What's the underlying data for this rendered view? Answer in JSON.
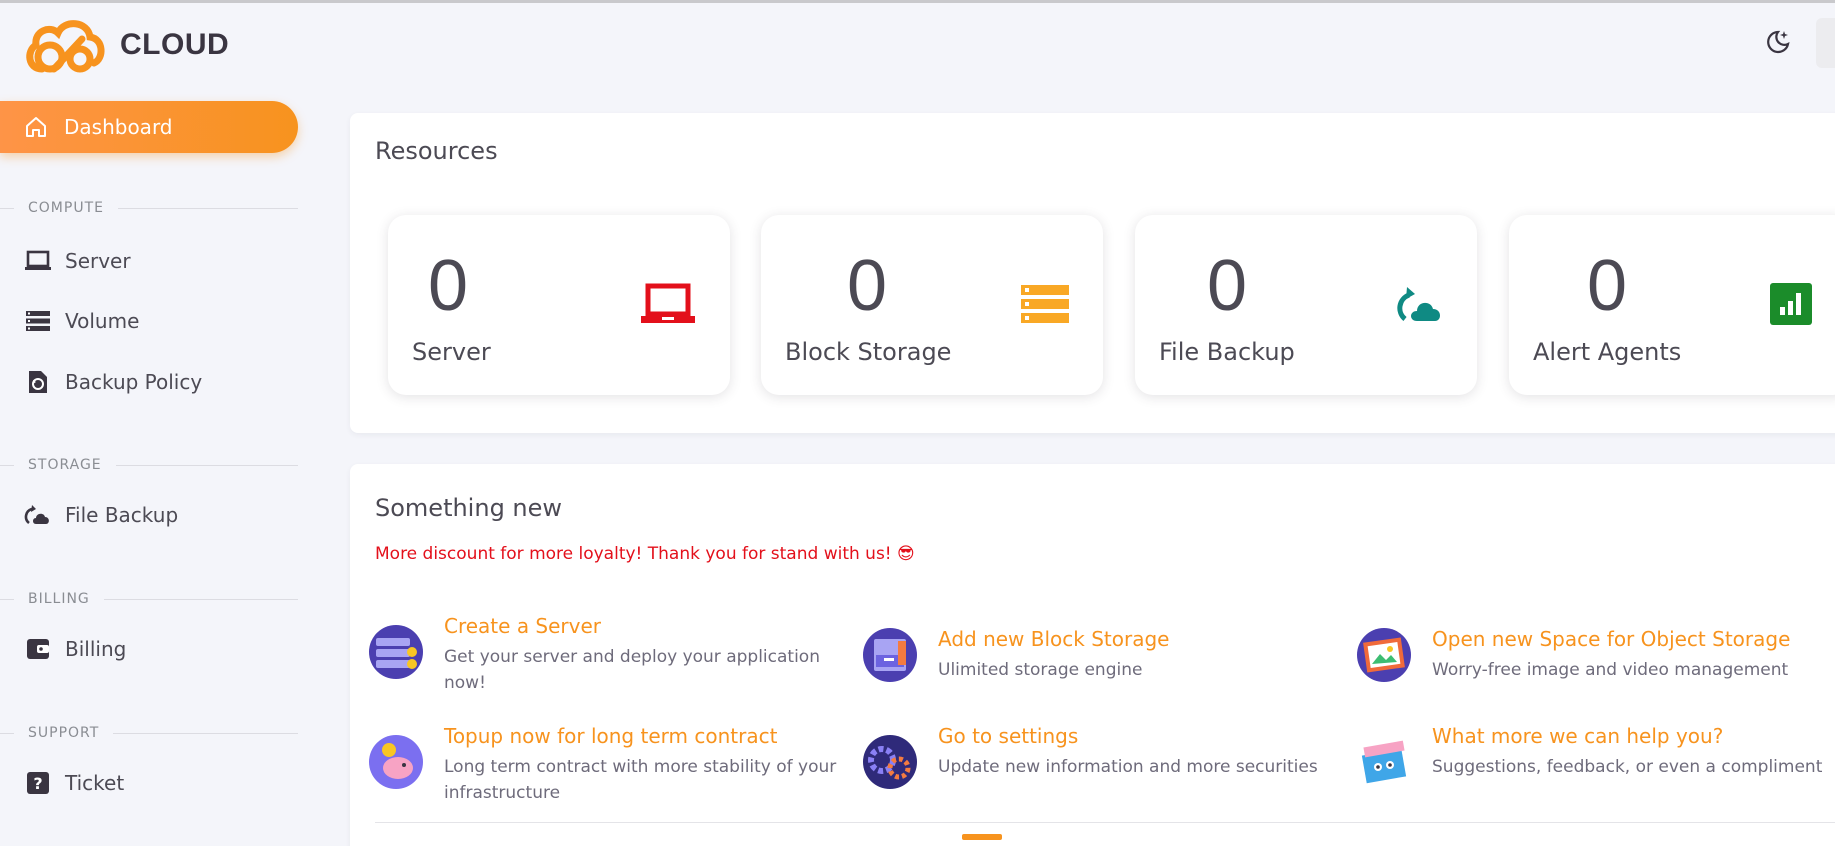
{
  "brand": {
    "name": "CLOUD"
  },
  "sidebar": {
    "active": {
      "label": "Dashboard",
      "icon": "home-icon"
    },
    "sections": [
      {
        "label": "COMPUTE",
        "items": [
          {
            "label": "Server",
            "icon": "laptop-icon"
          },
          {
            "label": "Volume",
            "icon": "stack-icon"
          },
          {
            "label": "Backup Policy",
            "icon": "backup-file-icon"
          }
        ]
      },
      {
        "label": "STORAGE",
        "items": [
          {
            "label": "File Backup",
            "icon": "cloud-sync-icon"
          }
        ]
      },
      {
        "label": "BILLING",
        "items": [
          {
            "label": "Billing",
            "icon": "wallet-icon"
          }
        ]
      },
      {
        "label": "SUPPORT",
        "items": [
          {
            "label": "Ticket",
            "icon": "question-icon"
          }
        ]
      }
    ]
  },
  "resources": {
    "title": "Resources",
    "stats": [
      {
        "value": "0",
        "label": "Server",
        "icon": "laptop-icon",
        "color": "#e3101b"
      },
      {
        "value": "0",
        "label": "Block Storage",
        "icon": "stack-icon",
        "color": "#f9a825"
      },
      {
        "value": "0",
        "label": "File Backup",
        "icon": "cloud-sync-icon",
        "color": "#0f8a83"
      },
      {
        "value": "0",
        "label": "Alert Agents",
        "icon": "chart-icon",
        "color": "#1b8c2a"
      }
    ]
  },
  "news": {
    "title": "Something new",
    "promo": "More discount for more loyalty! Thank you for stand with us! 😎",
    "features": [
      {
        "title": "Create a Server",
        "desc": "Get your server and deploy your application now!"
      },
      {
        "title": "Add new Block Storage",
        "desc": "Ulimited storage engine"
      },
      {
        "title": "Open new Space for Object Storage",
        "desc": "Worry-free image and video management"
      },
      {
        "title": "Topup now for long term contract",
        "desc": "Long term contract with more stability of your infrastructure"
      },
      {
        "title": "Go to settings",
        "desc": "Update new information and more securities"
      },
      {
        "title": "What more we can help you?",
        "desc": "Suggestions, feedback, or even a compliment"
      }
    ]
  },
  "colors": {
    "accent": "#f7931e",
    "promo": "#e3101b",
    "background": "#f4f5fa"
  }
}
